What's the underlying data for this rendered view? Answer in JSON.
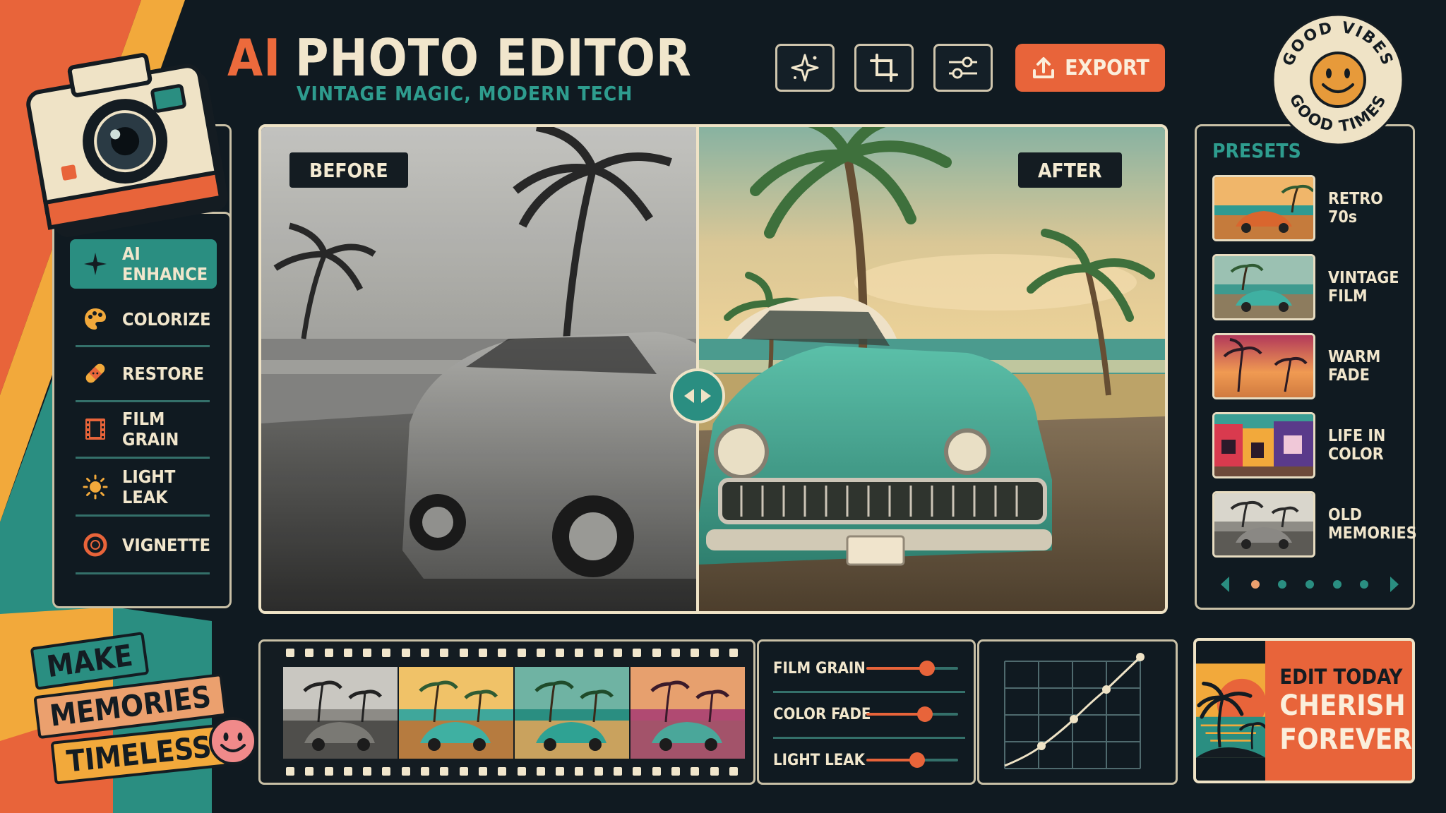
{
  "app": {
    "title_ai": "AI",
    "title_main": "PHOTO EDITOR",
    "subtitle": "VINTAGE MAGIC, MODERN TECH"
  },
  "toolbar": {
    "buttons": [
      {
        "icon": "sparkle-icon"
      },
      {
        "icon": "crop-icon"
      },
      {
        "icon": "sliders-icon"
      }
    ],
    "export_label": "EXPORT"
  },
  "badge": {
    "top_text": "GOOD VIBES",
    "bottom_text": "GOOD TIMES"
  },
  "sidebar": {
    "items": [
      {
        "label": "AI ENHANCE",
        "icon": "sparkle-icon",
        "active": true
      },
      {
        "label": "COLORIZE",
        "icon": "palette-icon"
      },
      {
        "label": "RESTORE",
        "icon": "bandage-icon"
      },
      {
        "label": "FILM GRAIN",
        "icon": "film-icon"
      },
      {
        "label": "LIGHT LEAK",
        "icon": "sun-icon"
      },
      {
        "label": "VIGNETTE",
        "icon": "vignette-icon"
      }
    ]
  },
  "canvas": {
    "before_label": "BEFORE",
    "after_label": "AFTER"
  },
  "presets": {
    "title": "PRESETS",
    "items": [
      {
        "label": "RETRO 70s"
      },
      {
        "label": "VINTAGE FILM"
      },
      {
        "label": "WARM FADE"
      },
      {
        "label": "LIFE IN COLOR"
      },
      {
        "label": "OLD MEMORIES"
      }
    ],
    "page_count": 5,
    "active_page": 1
  },
  "adjustments": {
    "sliders": [
      {
        "label": "FILM GRAIN",
        "value": 0.66
      },
      {
        "label": "COLOR FADE",
        "value": 0.64
      },
      {
        "label": "LIGHT LEAK",
        "value": 0.55
      }
    ]
  },
  "promo": {
    "line1": "EDIT TODAY",
    "line2": "CHERISH",
    "line3": "FOREVER"
  },
  "sticker": {
    "line1": "MAKE",
    "line2": "MEMORIES",
    "line3": "TIMELESS"
  },
  "colors": {
    "background": "#101a21",
    "accent_orange": "#e8643a",
    "accent_teal": "#2a8e81",
    "cream": "#f1e6cc",
    "yellow": "#f2a93b"
  }
}
